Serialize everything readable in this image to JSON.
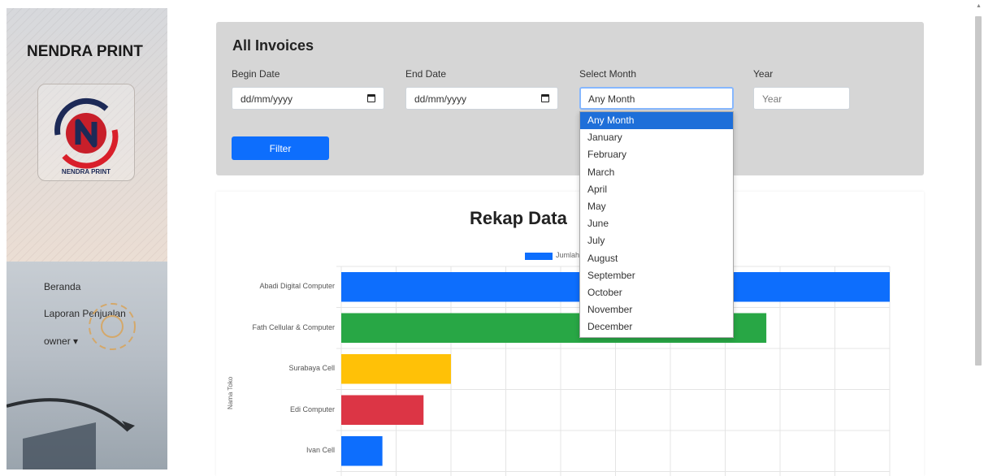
{
  "sidebar": {
    "brand": "NENDRA PRINT",
    "logo_caption": "NENDRA PRINT",
    "nav": [
      {
        "label": "Beranda"
      },
      {
        "label": "Laporan Penjualan"
      },
      {
        "label": "owner ▾"
      }
    ]
  },
  "filter": {
    "title": "All Invoices",
    "begin_label": "Begin Date",
    "begin_value": "dd/mm/yyyy",
    "end_label": "End Date",
    "end_value": "dd/mm/yyyy",
    "month_label": "Select Month",
    "month_value": "Any Month",
    "year_label": "Year",
    "year_placeholder": "Year",
    "button": "Filter"
  },
  "dropdown": {
    "options": [
      "Any Month",
      "January",
      "February",
      "March",
      "April",
      "May",
      "June",
      "July",
      "August",
      "September",
      "October",
      "November",
      "December"
    ],
    "selected": "Any Month"
  },
  "chart_data": {
    "type": "bar",
    "orientation": "horizontal",
    "title": "Rekap Data",
    "legend": "Jumlah",
    "ylabel": "Nama Toko",
    "categories": [
      "Abadi Digital Computer",
      "Fath Cellular & Computer",
      "Surabaya Cell",
      "Edi Computer",
      "Ivan Cell"
    ],
    "values": [
      20,
      15.5,
      4,
      3,
      1.5
    ],
    "colors": [
      "#0d6efd",
      "#28a745",
      "#ffc107",
      "#dc3545",
      "#0d6efd"
    ],
    "xlim": [
      0,
      20
    ],
    "grid": true
  }
}
